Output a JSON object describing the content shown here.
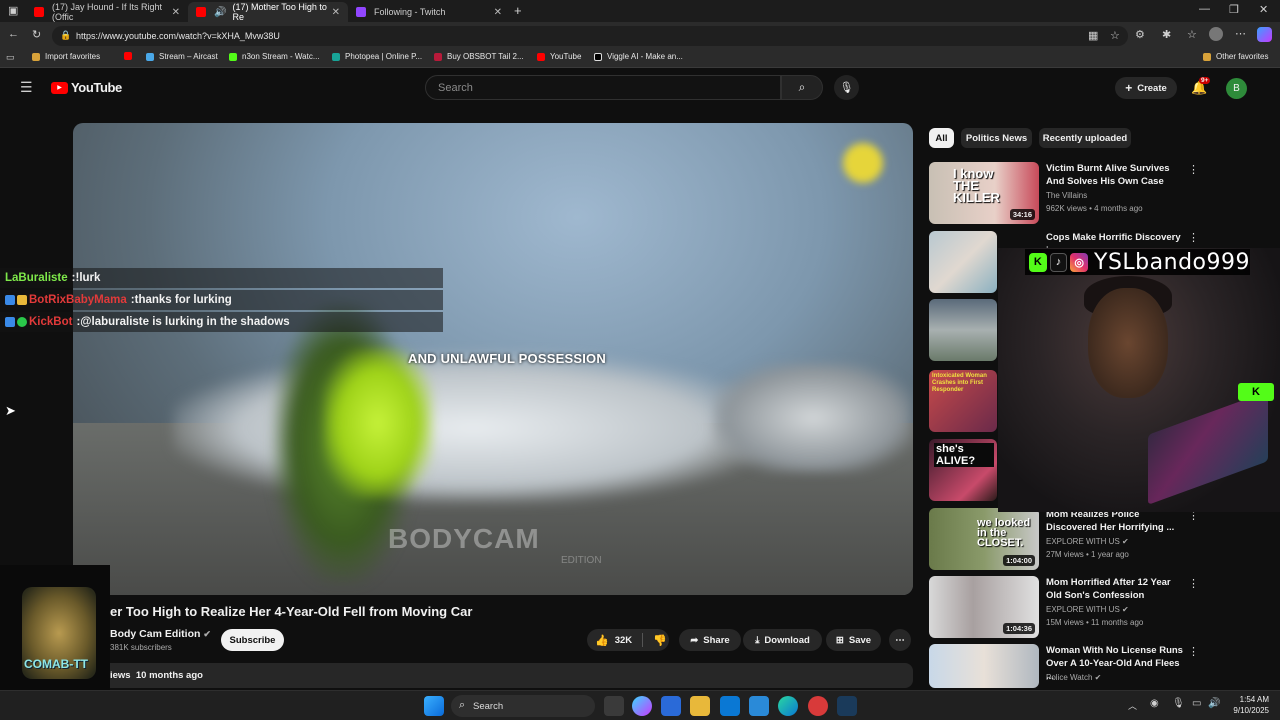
{
  "browser": {
    "tabs": [
      {
        "title": "(17) Jay Hound - If Its Right (Offic",
        "close": "✕"
      },
      {
        "title": "(17) Mother Too High to Re",
        "close": "✕"
      },
      {
        "title": "Following - Twitch",
        "close": "✕"
      }
    ],
    "new_tab": "+",
    "url": "https://www.youtube.com/watch?v=kXHA_Mvw38U",
    "bookmarks": [
      "Import favorites",
      "Stream – Aircast",
      "n3on Stream - Watc...",
      "Photopea | Online P...",
      "Buy OBSBOT Tail 2...",
      "YouTube",
      "Viggle AI - Make an..."
    ],
    "other_favorites": "Other favorites"
  },
  "youtube": {
    "logo": "YouTube",
    "search_placeholder": "Search",
    "create_label": "Create",
    "notif_badge": "9+",
    "avatar_letter": "B"
  },
  "video": {
    "caption": "AND UNLAWFUL POSSESSION",
    "watermark": "BODYCAM",
    "watermark_sub": "EDITION",
    "title": "er Too High to Realize Her 4-Year-Old Fell from Moving Car",
    "channel": "Body Cam Edition",
    "subscribers": "381K subscribers",
    "subscribe_label": "Subscribe",
    "likes": "32K",
    "share_label": "Share",
    "download_label": "Download",
    "save_label": "Save",
    "views_fragment": "iews",
    "age": "10 months ago"
  },
  "chat": [
    {
      "user": "LaBuraliste",
      "sep": " : ",
      "msg": "!lurk",
      "color": "#7ee84a"
    },
    {
      "user": "BotRixBabyMama",
      "sep": " : ",
      "msg": "thanks for lurking",
      "color": "#e23a3a"
    },
    {
      "user": "KickBot",
      "sep": " : ",
      "msg": "@laburaliste is lurking in the shadows",
      "color": "#e23a3a"
    }
  ],
  "sidebar": {
    "chips": [
      "All",
      "Politics News",
      "Recently uploaded"
    ],
    "recommendations": [
      {
        "title": "Victim Burnt Alive Survives And Solves His Own Case",
        "channel": "The Villains",
        "meta": "962K views • 4 months ago",
        "duration": "34:16",
        "thumb_text": "I know THE KILLER"
      },
      {
        "title": "Cops Make Horrific Discovery in",
        "channel": "",
        "meta": "",
        "duration": "",
        "thumb_text": ""
      },
      {
        "title": "",
        "channel": "",
        "meta": "",
        "duration": "",
        "thumb_text": ""
      },
      {
        "title": "",
        "channel": "",
        "meta": "",
        "duration": "",
        "thumb_text": "Intoxicated Woman Crashes into First Responder"
      },
      {
        "title": "",
        "channel": "",
        "meta": "",
        "duration": "",
        "thumb_text": "she's ALIVE?"
      },
      {
        "title": "Mom Realizes Police Discovered Her Horrifying ...",
        "channel": "EXPLORE WITH US",
        "meta": "27M views • 1 year ago",
        "duration": "1:04:00",
        "thumb_text": "we looked in the CLOSET."
      },
      {
        "title": "Mom Horrified After 12 Year Old Son's Confession",
        "channel": "EXPLORE WITH US",
        "meta": "15M views • 11 months ago",
        "duration": "1:04:36",
        "thumb_text": ""
      },
      {
        "title": "Woman With No License Runs Over A 10-Year-Old And Flees ...",
        "channel": "Police Watch",
        "meta": "",
        "duration": "",
        "thumb_text": ""
      }
    ]
  },
  "stream_overlay": {
    "streamer_name": "YSLbando999",
    "logo_text": "COMAB-TT"
  },
  "taskbar": {
    "search_label": "Search",
    "time": "1:54 AM",
    "date": "9/10/2025"
  },
  "colors": {
    "yt_red": "#ff0000",
    "kick_green": "#53fc18",
    "bg": "#0f0f0f"
  }
}
